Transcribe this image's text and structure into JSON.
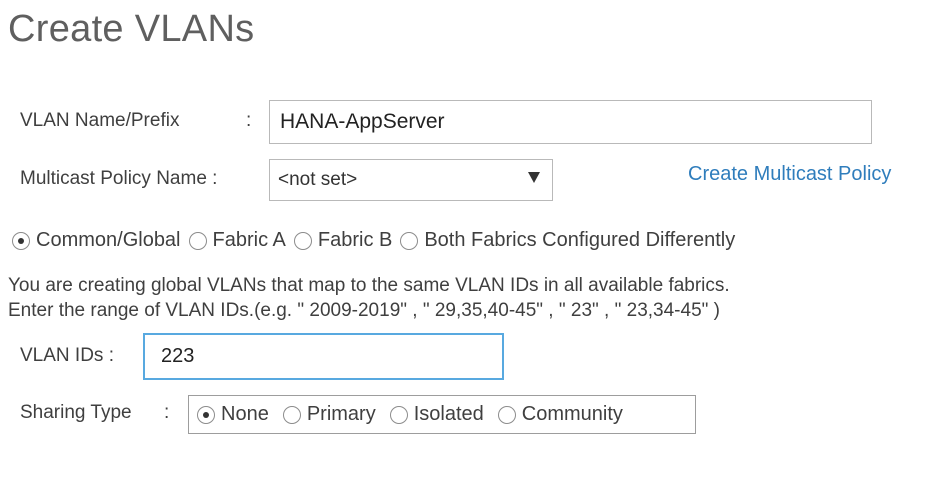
{
  "page": {
    "title": "Create VLANs"
  },
  "vlan_name": {
    "label": "VLAN Name/Prefix",
    "colon": ":",
    "value": "HANA-AppServer"
  },
  "multicast": {
    "label": "Multicast Policy Name :",
    "selected": "<not set>",
    "create_link": "Create Multicast Policy"
  },
  "fabric_options": [
    {
      "label": "Common/Global",
      "checked": true
    },
    {
      "label": "Fabric A",
      "checked": false
    },
    {
      "label": "Fabric B",
      "checked": false
    },
    {
      "label": "Both Fabrics Configured Differently",
      "checked": false
    }
  ],
  "info": {
    "line1": "You are creating global VLANs that map to the same VLAN IDs in all available fabrics.",
    "line2": "Enter the range of VLAN IDs.(e.g. \" 2009-2019\" , \" 29,35,40-45\" , \" 23\" , \" 23,34-45\" )"
  },
  "vlan_ids": {
    "label": "VLAN IDs :",
    "value": "223"
  },
  "sharing": {
    "label": "Sharing Type",
    "colon": ":",
    "options": [
      {
        "label": "None",
        "checked": true
      },
      {
        "label": "Primary",
        "checked": false
      },
      {
        "label": "Isolated",
        "checked": false
      },
      {
        "label": "Community",
        "checked": false
      }
    ]
  }
}
